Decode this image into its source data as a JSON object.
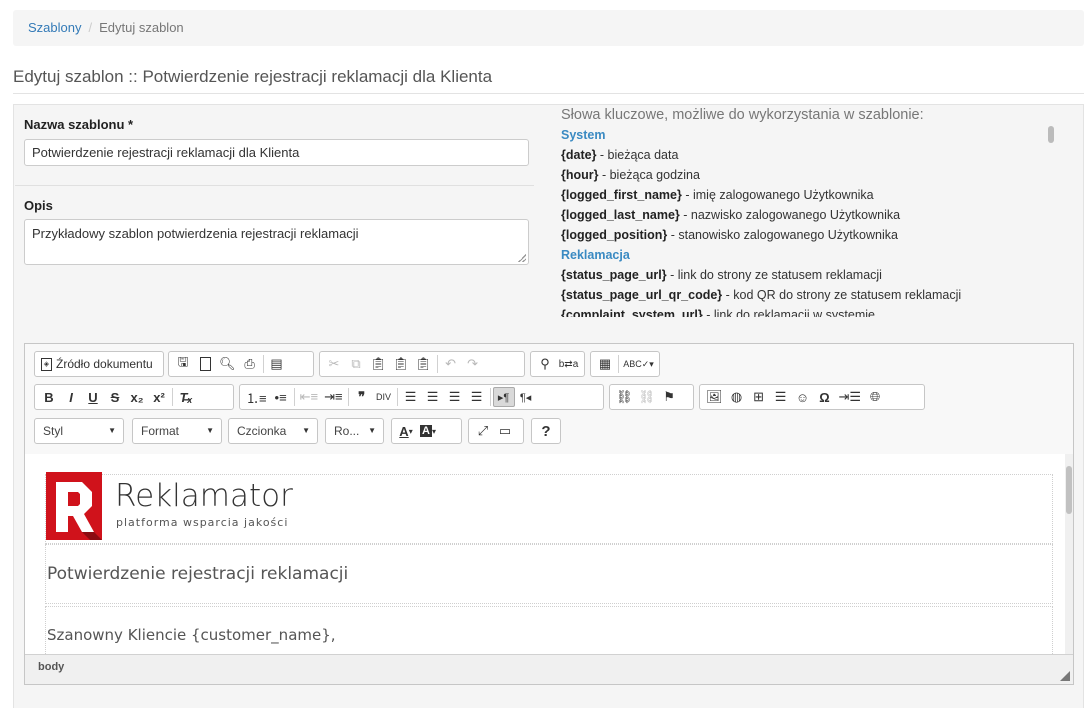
{
  "breadcrumb": {
    "link": "Szablony",
    "separator": "/",
    "current": "Edytuj szablon"
  },
  "page_title": "Edytuj szablon :: Potwierdzenie rejestracji reklamacji dla Klienta",
  "form": {
    "name_label": "Nazwa szablonu *",
    "name_value": "Potwierdzenie rejestracji reklamacji dla Klienta",
    "desc_label": "Opis",
    "desc_value": "Przykładowy szablon potwierdzenia rejestracji reklamacji"
  },
  "keywords": {
    "title": "Słowa kluczowe, możliwe do wykorzystania w szablonie:",
    "items": [
      {
        "type": "group",
        "text": "System"
      },
      {
        "type": "kw",
        "key": "{date}",
        "desc": " - bieżąca data"
      },
      {
        "type": "kw",
        "key": "{hour}",
        "desc": " - bieżąca godzina"
      },
      {
        "type": "kw",
        "key": "{logged_first_name}",
        "desc": " - imię zalogowanego Użytkownika"
      },
      {
        "type": "kw",
        "key": "{logged_last_name}",
        "desc": " - nazwisko zalogowanego Użytkownika"
      },
      {
        "type": "kw",
        "key": "{logged_position}",
        "desc": " - stanowisko zalogowanego Użytkownika"
      },
      {
        "type": "group",
        "text": "Reklamacja"
      },
      {
        "type": "kw",
        "key": "{status_page_url}",
        "desc": " - link do strony ze statusem reklamacji"
      },
      {
        "type": "kw",
        "key": "{status_page_url_qr_code}",
        "desc": " - kod QR do strony ze statusem reklamacji"
      },
      {
        "type": "kw",
        "key": "{complaint_system_url}",
        "desc": " - link do reklamacji w systemie"
      }
    ]
  },
  "editor": {
    "source_label": "Źródło dokumentu",
    "style_combo": "Styl",
    "format_combo": "Format",
    "font_combo": "Czcionka",
    "size_combo": "Ro...",
    "help_label": "?",
    "status_path": "body",
    "content": {
      "logo_title": "Reklamator",
      "logo_subtitle": "platforma wsparcia jakości",
      "heading": "Potwierdzenie rejestracji reklamacji",
      "greeting": "Szanowny Kliencie {customer_name},"
    },
    "icons": {
      "row1": [
        "source-icon",
        "save-icon",
        "new-page-icon",
        "preview-icon",
        "print-icon",
        "templates-icon",
        "cut-icon",
        "copy-icon",
        "paste-icon",
        "paste-text-icon",
        "paste-word-icon",
        "undo-icon",
        "redo-icon",
        "find-icon",
        "replace-icon",
        "select-all-icon",
        "spellcheck-icon"
      ],
      "row2": [
        "bold-icon",
        "italic-icon",
        "underline-icon",
        "strike-icon",
        "subscript-icon",
        "superscript-icon",
        "remove-format-icon",
        "numbered-list-icon",
        "bulleted-list-icon",
        "outdent-icon",
        "indent-icon",
        "blockquote-icon",
        "div-icon",
        "align-left-icon",
        "align-center-icon",
        "align-right-icon",
        "justify-icon",
        "ltr-icon",
        "rtl-icon",
        "link-icon",
        "unlink-icon",
        "anchor-icon",
        "image-icon",
        "flash-icon",
        "table-icon",
        "horizontal-rule-icon",
        "smiley-icon",
        "special-char-icon",
        "page-break-icon",
        "iframe-icon"
      ],
      "row3": [
        "text-color-icon",
        "bg-color-icon",
        "maximize-icon",
        "show-blocks-icon",
        "help-icon"
      ]
    }
  },
  "colors": {
    "link": "#337ab7",
    "keyword_group": "#3a8ac2",
    "logo_red": "#d0121b"
  }
}
